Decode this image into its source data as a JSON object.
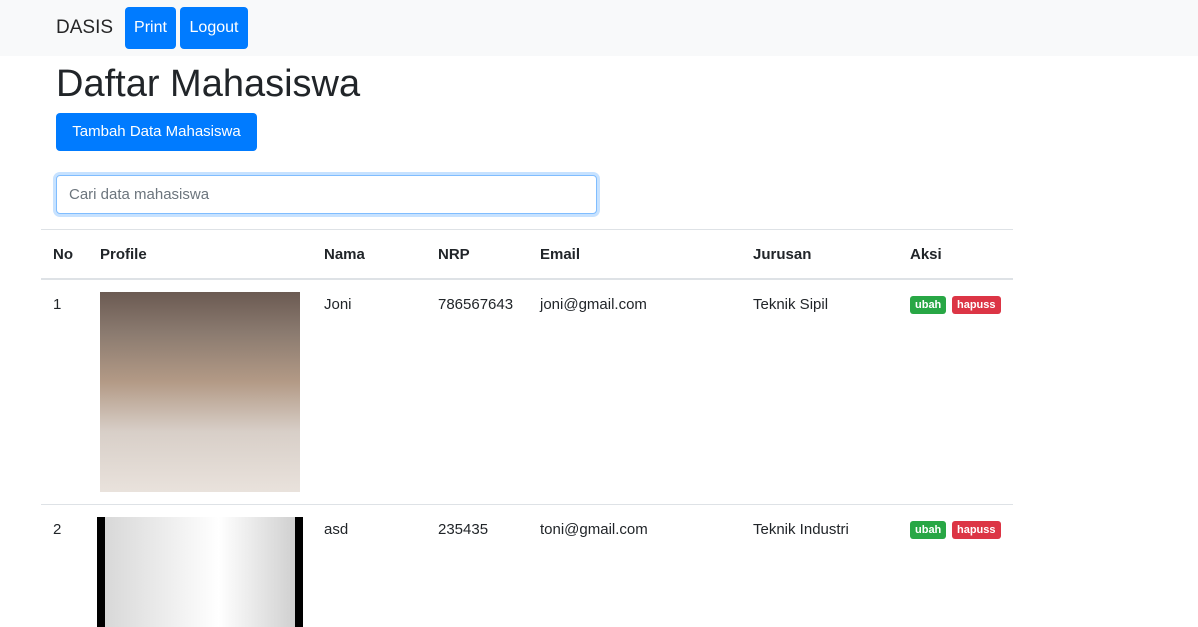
{
  "navbar": {
    "brand": "DASIS",
    "print_label": "Print",
    "logout_label": "Logout"
  },
  "page": {
    "title": "Daftar Mahasiswa",
    "add_label": "Tambah Data Mahasiswa"
  },
  "search": {
    "placeholder": "Cari data mahasiswa",
    "value": ""
  },
  "table": {
    "headers": [
      "No",
      "Profile",
      "Nama",
      "NRP",
      "Email",
      "Jurusan",
      "Aksi"
    ],
    "rows": [
      {
        "no": "1",
        "nama": "Joni",
        "nrp": "786567643",
        "email": "joni@gmail.com",
        "jurusan": "Teknik Sipil",
        "ubah": "ubah",
        "hapus": "hapuss"
      },
      {
        "no": "2",
        "nama": "asd",
        "nrp": "235435",
        "email": "toni@gmail.com",
        "jurusan": "Teknik Industri",
        "ubah": "ubah",
        "hapus": "hapuss"
      }
    ]
  },
  "colors": {
    "primary": "#007bff",
    "success": "#28a745",
    "danger": "#dc3545",
    "navbar_bg": "#f8f9fa"
  }
}
